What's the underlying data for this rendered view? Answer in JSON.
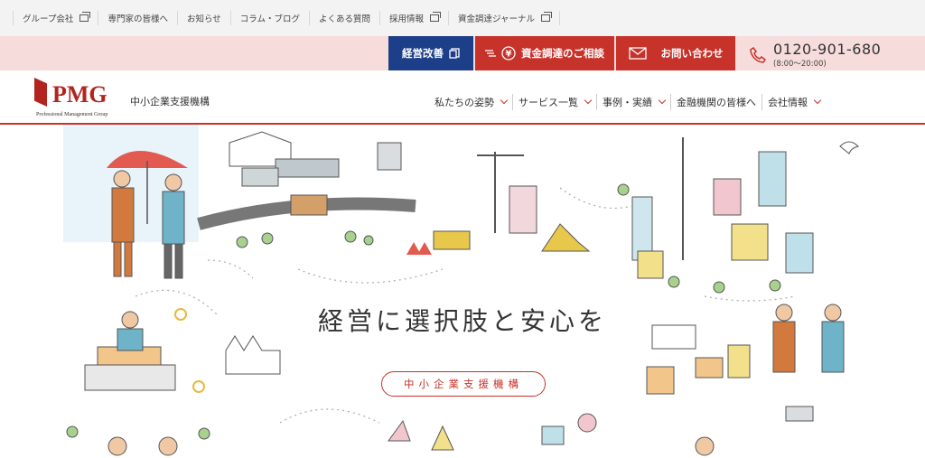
{
  "topbar": {
    "links": [
      {
        "label": "グループ会社",
        "external": true
      },
      {
        "label": "専門家の皆様へ",
        "external": false
      },
      {
        "label": "お知らせ",
        "external": false
      },
      {
        "label": "コラム・ブログ",
        "external": false
      },
      {
        "label": "よくある質問",
        "external": false
      },
      {
        "label": "採用情報",
        "external": true
      },
      {
        "label": "資金調達ジャーナル",
        "external": true
      }
    ]
  },
  "cta": {
    "improve_label": "経営改善",
    "finance_label": "資金調達のご相談",
    "contact_label": "お問い合わせ",
    "phone_number": "0120-901-680",
    "phone_hours": "(8:00〜20:00)"
  },
  "header": {
    "logo_text": "PMG",
    "logo_sub": "Professional Management Group",
    "tagline": "中小企業支援機構",
    "nav": [
      {
        "label": "私たちの姿勢",
        "dropdown": true
      },
      {
        "label": "サービス一覧",
        "dropdown": true
      },
      {
        "label": "事例・実績",
        "dropdown": true
      },
      {
        "label": "金融機関の皆様へ",
        "dropdown": false
      },
      {
        "label": "会社情報",
        "dropdown": true
      }
    ]
  },
  "hero": {
    "headline": "経営に選択肢と安心を",
    "badge": "中小企業支援機構"
  },
  "colors": {
    "brand_red": "#c7322a",
    "navy": "#1d3f8a",
    "pink_band": "#f7dcdc"
  }
}
